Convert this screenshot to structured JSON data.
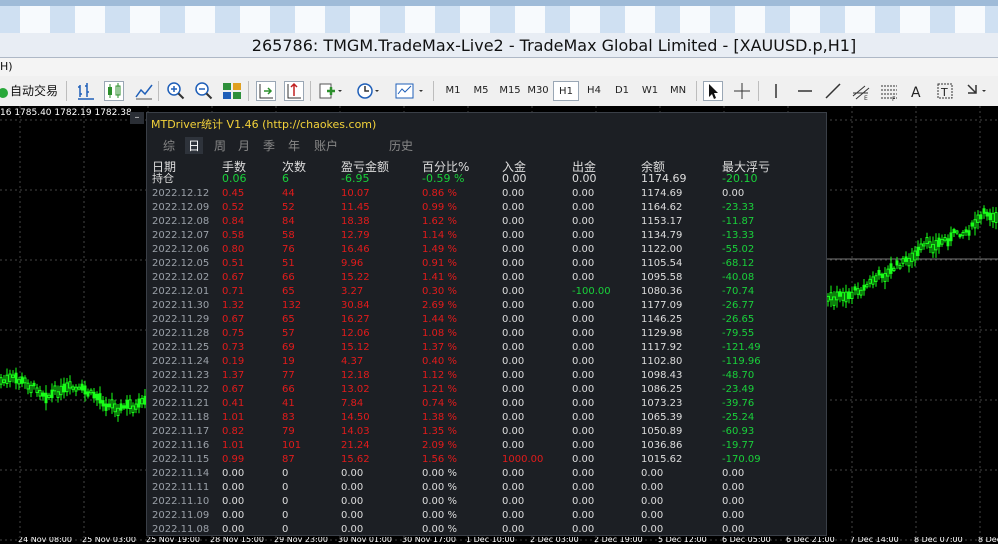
{
  "window": {
    "title": "265786: TMGM.TradeMax-Live2 - TradeMax Global Limited - [XAUUSD.p,H1]"
  },
  "menubar": {
    "partial_label": "H)"
  },
  "toolbar": {
    "autotrade_label": "自动交易",
    "timeframes": [
      "M1",
      "M5",
      "M15",
      "M30",
      "H1",
      "H4",
      "D1",
      "W1",
      "MN"
    ],
    "active_timeframe": "H1"
  },
  "chart": {
    "ohlc_text": "16 1785.40 1782.19 1782.38",
    "candle_color": "#19ff19",
    "x_labels": [
      "24 Nov 08:00",
      "25 Nov 03:00",
      "25 Nov 19:00",
      "28 Nov 15:00",
      "29 Nov 23:00",
      "30 Nov 01:00",
      "30 Nov 17:00",
      "1 Dec 10:00",
      "2 Dec 03:00",
      "2 Dec 19:00",
      "5 Dec 12:00",
      "6 Dec 05:00",
      "6 Dec 21:00",
      "7 Dec 14:00",
      "8 Dec 07:00",
      "8 Dec 2"
    ]
  },
  "panel": {
    "title": "MTDriver统计 V1.46  (http://chaokes.com)",
    "minimize_label": "–",
    "tabs": [
      "综",
      "日",
      "周",
      "月",
      "季",
      "年",
      "账户",
      "历史"
    ],
    "active_tab": "日",
    "headers": {
      "date": "日期",
      "lots": "手数",
      "count": "次数",
      "pnl": "盈亏金额",
      "pct": "百分比%",
      "deposit": "入金",
      "withdraw": "出金",
      "balance": "余额",
      "max_dd": "最大浮亏"
    },
    "holding": {
      "label": "持仓",
      "lots": "0.06",
      "count": "6",
      "pnl": "-6.95",
      "pct": "-0.59 %",
      "deposit": "0.00",
      "withdraw": "0.00",
      "balance": "1174.69",
      "max_dd": "-20.10"
    },
    "rows": [
      {
        "date": "2022.12.12",
        "lots": "0.45",
        "count": "44",
        "pnl": "10.07",
        "pct": "0.86 %",
        "deposit": "0.00",
        "withdraw": "0.00",
        "balance": "1174.69",
        "max_dd": "0.00"
      },
      {
        "date": "2022.12.09",
        "lots": "0.52",
        "count": "52",
        "pnl": "11.45",
        "pct": "0.99 %",
        "deposit": "0.00",
        "withdraw": "0.00",
        "balance": "1164.62",
        "max_dd": "-23.33"
      },
      {
        "date": "2022.12.08",
        "lots": "0.84",
        "count": "84",
        "pnl": "18.38",
        "pct": "1.62 %",
        "deposit": "0.00",
        "withdraw": "0.00",
        "balance": "1153.17",
        "max_dd": "-11.87"
      },
      {
        "date": "2022.12.07",
        "lots": "0.58",
        "count": "58",
        "pnl": "12.79",
        "pct": "1.14 %",
        "deposit": "0.00",
        "withdraw": "0.00",
        "balance": "1134.79",
        "max_dd": "-13.33"
      },
      {
        "date": "2022.12.06",
        "lots": "0.80",
        "count": "76",
        "pnl": "16.46",
        "pct": "1.49 %",
        "deposit": "0.00",
        "withdraw": "0.00",
        "balance": "1122.00",
        "max_dd": "-55.02"
      },
      {
        "date": "2022.12.05",
        "lots": "0.51",
        "count": "51",
        "pnl": "9.96",
        "pct": "0.91 %",
        "deposit": "0.00",
        "withdraw": "0.00",
        "balance": "1105.54",
        "max_dd": "-68.12"
      },
      {
        "date": "2022.12.02",
        "lots": "0.67",
        "count": "66",
        "pnl": "15.22",
        "pct": "1.41 %",
        "deposit": "0.00",
        "withdraw": "0.00",
        "balance": "1095.58",
        "max_dd": "-40.08"
      },
      {
        "date": "2022.12.01",
        "lots": "0.71",
        "count": "65",
        "pnl": "3.27",
        "pct": "0.30 %",
        "deposit": "0.00",
        "withdraw": "-100.00",
        "balance": "1080.36",
        "max_dd": "-70.74"
      },
      {
        "date": "2022.11.30",
        "lots": "1.32",
        "count": "132",
        "pnl": "30.84",
        "pct": "2.69 %",
        "deposit": "0.00",
        "withdraw": "0.00",
        "balance": "1177.09",
        "max_dd": "-26.77"
      },
      {
        "date": "2022.11.29",
        "lots": "0.67",
        "count": "65",
        "pnl": "16.27",
        "pct": "1.44 %",
        "deposit": "0.00",
        "withdraw": "0.00",
        "balance": "1146.25",
        "max_dd": "-26.65"
      },
      {
        "date": "2022.11.28",
        "lots": "0.75",
        "count": "57",
        "pnl": "12.06",
        "pct": "1.08 %",
        "deposit": "0.00",
        "withdraw": "0.00",
        "balance": "1129.98",
        "max_dd": "-79.55"
      },
      {
        "date": "2022.11.25",
        "lots": "0.73",
        "count": "69",
        "pnl": "15.12",
        "pct": "1.37 %",
        "deposit": "0.00",
        "withdraw": "0.00",
        "balance": "1117.92",
        "max_dd": "-121.49"
      },
      {
        "date": "2022.11.24",
        "lots": "0.19",
        "count": "19",
        "pnl": "4.37",
        "pct": "0.40 %",
        "deposit": "0.00",
        "withdraw": "0.00",
        "balance": "1102.80",
        "max_dd": "-119.96"
      },
      {
        "date": "2022.11.23",
        "lots": "1.37",
        "count": "77",
        "pnl": "12.18",
        "pct": "1.12 %",
        "deposit": "0.00",
        "withdraw": "0.00",
        "balance": "1098.43",
        "max_dd": "-48.70"
      },
      {
        "date": "2022.11.22",
        "lots": "0.67",
        "count": "66",
        "pnl": "13.02",
        "pct": "1.21 %",
        "deposit": "0.00",
        "withdraw": "0.00",
        "balance": "1086.25",
        "max_dd": "-23.49"
      },
      {
        "date": "2022.11.21",
        "lots": "0.41",
        "count": "41",
        "pnl": "7.84",
        "pct": "0.74 %",
        "deposit": "0.00",
        "withdraw": "0.00",
        "balance": "1073.23",
        "max_dd": "-39.76"
      },
      {
        "date": "2022.11.18",
        "lots": "1.01",
        "count": "83",
        "pnl": "14.50",
        "pct": "1.38 %",
        "deposit": "0.00",
        "withdraw": "0.00",
        "balance": "1065.39",
        "max_dd": "-25.24"
      },
      {
        "date": "2022.11.17",
        "lots": "0.82",
        "count": "79",
        "pnl": "14.03",
        "pct": "1.35 %",
        "deposit": "0.00",
        "withdraw": "0.00",
        "balance": "1050.89",
        "max_dd": "-60.93"
      },
      {
        "date": "2022.11.16",
        "lots": "1.01",
        "count": "101",
        "pnl": "21.24",
        "pct": "2.09 %",
        "deposit": "0.00",
        "withdraw": "0.00",
        "balance": "1036.86",
        "max_dd": "-19.77"
      },
      {
        "date": "2022.11.15",
        "lots": "0.99",
        "count": "87",
        "pnl": "15.62",
        "pct": "1.56 %",
        "deposit": "1000.00",
        "withdraw": "0.00",
        "balance": "1015.62",
        "max_dd": "-170.09"
      },
      {
        "date": "2022.11.14",
        "lots": "0.00",
        "count": "0",
        "pnl": "0.00",
        "pct": "0.00 %",
        "deposit": "0.00",
        "withdraw": "0.00",
        "balance": "0.00",
        "max_dd": "0.00"
      },
      {
        "date": "2022.11.11",
        "lots": "0.00",
        "count": "0",
        "pnl": "0.00",
        "pct": "0.00 %",
        "deposit": "0.00",
        "withdraw": "0.00",
        "balance": "0.00",
        "max_dd": "0.00"
      },
      {
        "date": "2022.11.10",
        "lots": "0.00",
        "count": "0",
        "pnl": "0.00",
        "pct": "0.00 %",
        "deposit": "0.00",
        "withdraw": "0.00",
        "balance": "0.00",
        "max_dd": "0.00"
      },
      {
        "date": "2022.11.09",
        "lots": "0.00",
        "count": "0",
        "pnl": "0.00",
        "pct": "0.00 %",
        "deposit": "0.00",
        "withdraw": "0.00",
        "balance": "0.00",
        "max_dd": "0.00"
      },
      {
        "date": "2022.11.08",
        "lots": "0.00",
        "count": "0",
        "pnl": "0.00",
        "pct": "0.00 %",
        "deposit": "0.00",
        "withdraw": "0.00",
        "balance": "0.00",
        "max_dd": "0.00"
      }
    ]
  },
  "icons": [
    "autotrade-icon",
    "bar-chart-icon",
    "candle-chart-icon",
    "line-chart-icon",
    "zoom-in-icon",
    "zoom-out-icon",
    "tile-icon",
    "scroll-icon",
    "shift-icon",
    "new-order-icon",
    "clock-icon",
    "template-icon",
    "cursor-icon",
    "crosshair-icon",
    "vertical-line-icon",
    "horizontal-line-icon",
    "trendline-icon",
    "fibo-icon",
    "channel-icon",
    "text-icon",
    "label-icon",
    "arrows-icon"
  ]
}
